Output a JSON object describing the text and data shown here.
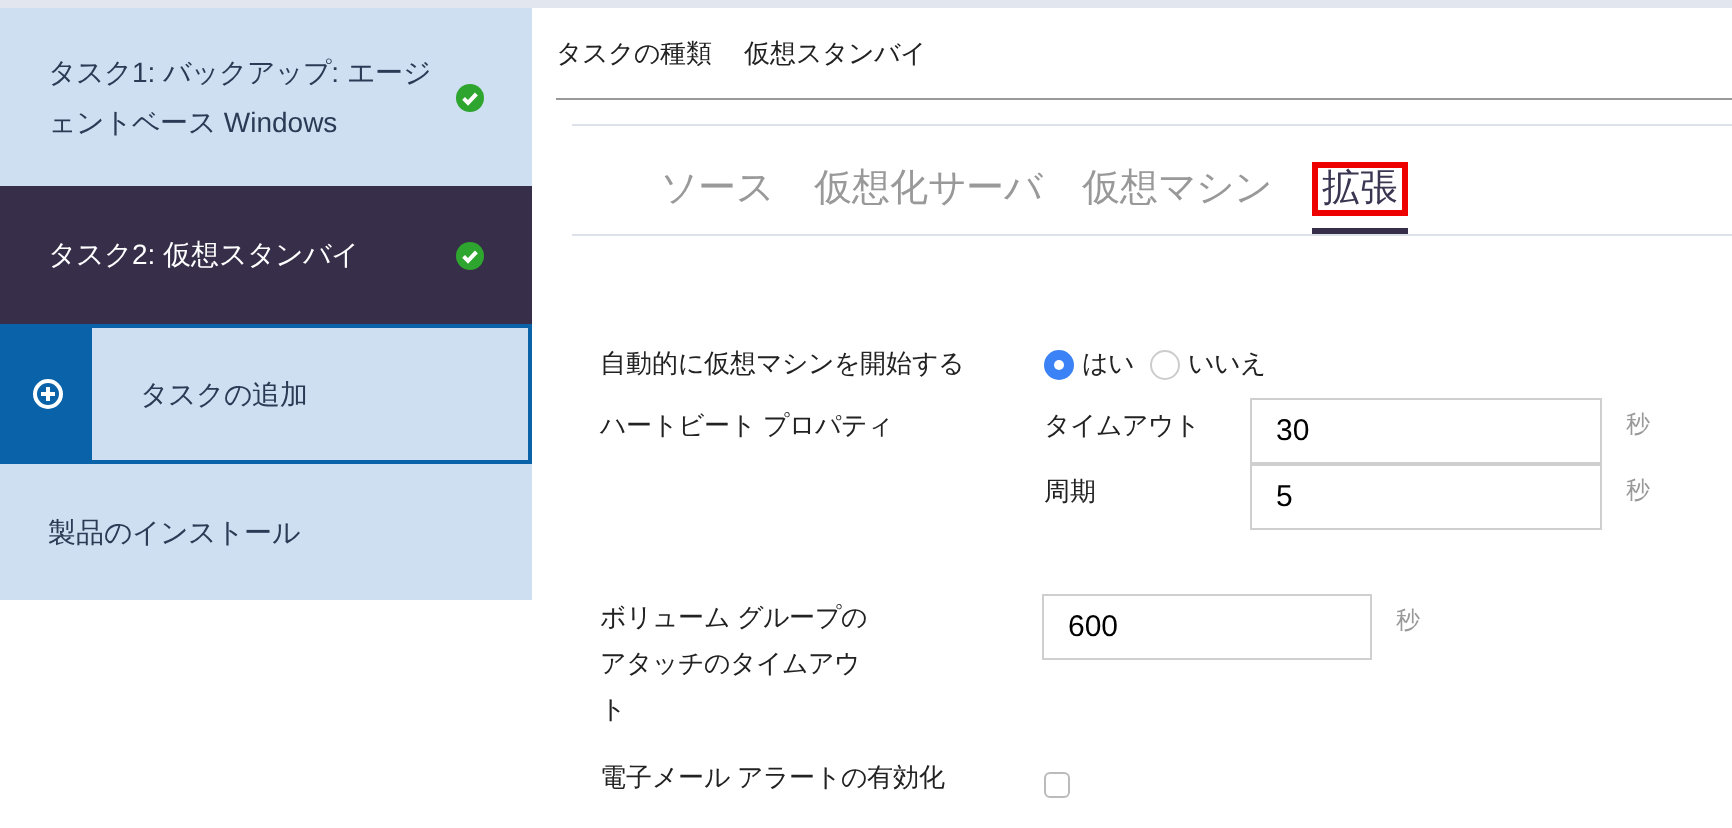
{
  "sidebar": {
    "items": [
      {
        "kind": "task",
        "label": "タスク1: バックアップ: エージェントベース Windows",
        "selected": false,
        "done": true
      },
      {
        "kind": "task",
        "label": "タスク2: 仮想スタンバイ",
        "selected": true,
        "done": true
      },
      {
        "kind": "add",
        "label": "タスクの追加",
        "selected": false
      },
      {
        "kind": "install",
        "label": "製品のインストール",
        "selected": false
      }
    ]
  },
  "task_type": {
    "label": "タスクの種類",
    "value": "仮想スタンバイ"
  },
  "tabs": [
    {
      "label": "ソース",
      "selected": false,
      "highlighted": false
    },
    {
      "label": "仮想化サーバ",
      "selected": false,
      "highlighted": false
    },
    {
      "label": "仮想マシン",
      "selected": false,
      "highlighted": false
    },
    {
      "label": "拡張",
      "selected": true,
      "highlighted": true
    }
  ],
  "auto_start": {
    "label": "自動的に仮想マシンを開始する",
    "options": [
      {
        "label": "はい",
        "selected": true
      },
      {
        "label": "いいえ",
        "selected": false
      }
    ]
  },
  "heartbeat": {
    "label": "ハートビート プロパティ",
    "fields": [
      {
        "label": "タイムアウト",
        "value": "30",
        "unit": "秒"
      },
      {
        "label": "周期",
        "value": "5",
        "unit": "秒"
      }
    ]
  },
  "volume_timeout": {
    "label": "ボリューム グループのアタッチのタイムアウト",
    "value": "600",
    "unit": "秒"
  },
  "email_alert": {
    "label": "電子メール アラートの有効化",
    "checked": false
  }
}
